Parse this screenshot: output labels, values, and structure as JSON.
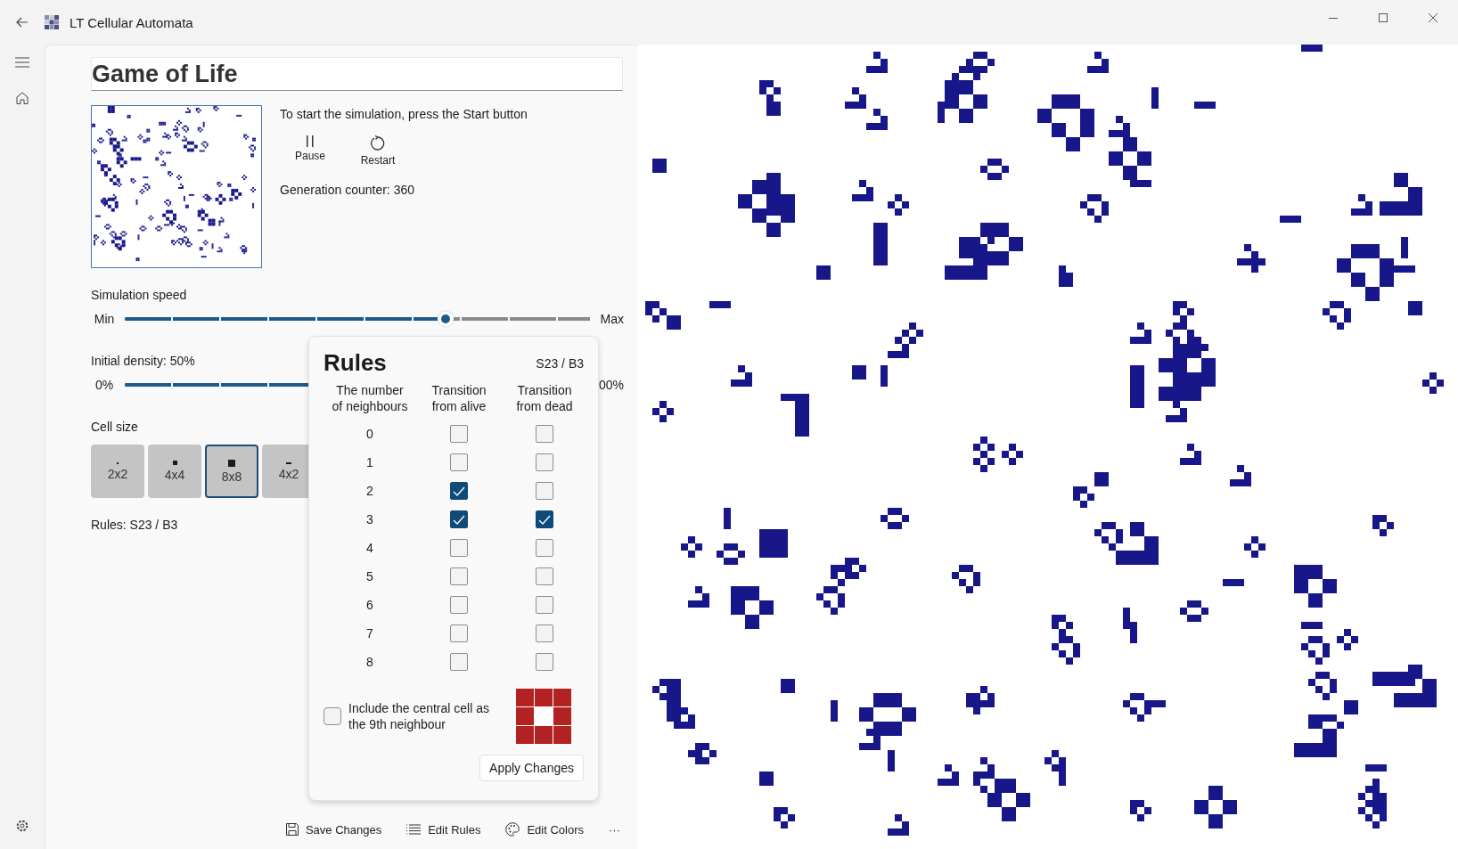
{
  "window": {
    "title": "LT Cellular Automata"
  },
  "editor": {
    "title": "Game of Life",
    "hint": "To start the simulation, press the Start button",
    "actions": [
      {
        "label": "Pause",
        "kind": "pause"
      },
      {
        "label": "Restart",
        "kind": "restart"
      }
    ],
    "generation": "Generation counter: 360",
    "speed": {
      "label": "Simulation speed",
      "min": "Min",
      "max": "Max",
      "level": 0.69
    },
    "density": {
      "label": "Initial density: 50%",
      "min": "0%",
      "max": "00%",
      "level": 0.5
    },
    "cell_size": {
      "label": "Cell size",
      "options": [
        {
          "label": "2x2",
          "kind": "tiny",
          "selected": false
        },
        {
          "label": "4x4",
          "kind": "small",
          "selected": false
        },
        {
          "label": "8x8",
          "kind": "medium",
          "selected": true
        },
        {
          "label": "4x2",
          "kind": "wide",
          "selected": false
        }
      ]
    },
    "rules_summary": "Rules: S23 / B3"
  },
  "rules_popup": {
    "title": "Rules",
    "notation": "S23 / B3",
    "columns": [
      "The number of neighbours",
      "Transition from alive",
      "Transition from dead"
    ],
    "rows": [
      {
        "n": "0",
        "alive": false,
        "dead": false
      },
      {
        "n": "1",
        "alive": false,
        "dead": false
      },
      {
        "n": "2",
        "alive": true,
        "dead": false
      },
      {
        "n": "3",
        "alive": true,
        "dead": true
      },
      {
        "n": "4",
        "alive": false,
        "dead": false
      },
      {
        "n": "5",
        "alive": false,
        "dead": false
      },
      {
        "n": "6",
        "alive": false,
        "dead": false
      },
      {
        "n": "7",
        "alive": false,
        "dead": false
      },
      {
        "n": "8",
        "alive": false,
        "dead": false
      }
    ],
    "central": {
      "label": "Include the central cell as the 9th neighbour",
      "checked": false
    },
    "apply": "Apply Changes"
  },
  "command_bar": [
    {
      "label": "Save Changes",
      "kind": "save"
    },
    {
      "label": "Edit Rules",
      "kind": "rules"
    },
    {
      "label": "Edit Colors",
      "kind": "colors"
    },
    {
      "label": "···",
      "kind": "more"
    }
  ]
}
